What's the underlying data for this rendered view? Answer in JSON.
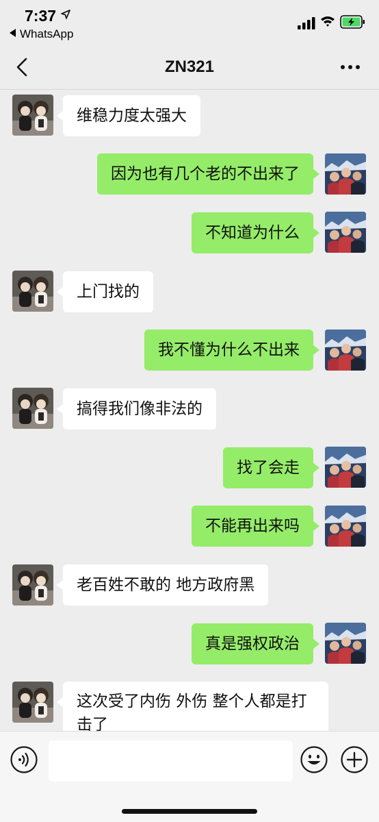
{
  "status_bar": {
    "time": "7:37",
    "back_app": "WhatsApp"
  },
  "navbar": {
    "title": "ZN321"
  },
  "colors": {
    "outgoing_bubble": "#95ec69",
    "incoming_bubble": "#ffffff",
    "background": "#ededed"
  },
  "messages": [
    {
      "direction": "in",
      "text": "维稳力度太强大"
    },
    {
      "direction": "out",
      "text": "因为也有几个老的不出来了"
    },
    {
      "direction": "out",
      "text": "不知道为什么"
    },
    {
      "direction": "in",
      "text": "上门找的"
    },
    {
      "direction": "out",
      "text": "我不懂为什么不出来"
    },
    {
      "direction": "in",
      "text": "搞得我们像非法的"
    },
    {
      "direction": "out",
      "text": "找了会走"
    },
    {
      "direction": "out",
      "text": "不能再出来吗"
    },
    {
      "direction": "in",
      "text": "老百姓不敢的  地方政府黑"
    },
    {
      "direction": "out",
      "text": "真是强权政治"
    },
    {
      "direction": "in",
      "text": "这次受了内伤 外伤  整个人都是打击了"
    }
  ],
  "input_bar": {
    "placeholder": "",
    "icons": [
      "voice-icon",
      "emoji-icon",
      "plus-icon"
    ]
  }
}
